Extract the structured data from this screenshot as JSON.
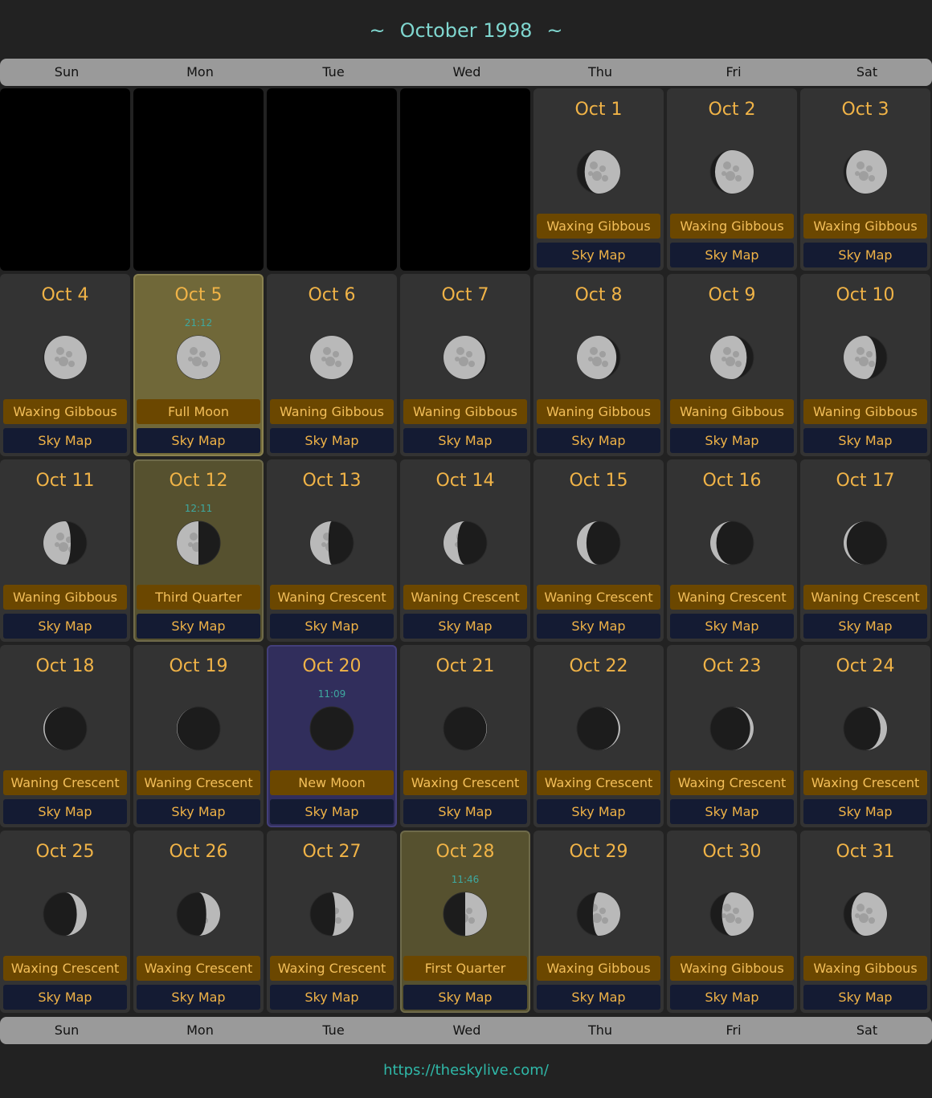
{
  "title": "October 1998",
  "title_decoration": "~",
  "weekdays": [
    "Sun",
    "Mon",
    "Tue",
    "Wed",
    "Thu",
    "Fri",
    "Sat"
  ],
  "sky_map_label": "Sky Map",
  "footer_url": "https://theskylive.com/",
  "first_weekday_index": 4,
  "days": [
    {
      "date": "Oct 1",
      "phase": "Waxing Gibbous",
      "illumination": 0.82,
      "waxing": true
    },
    {
      "date": "Oct 2",
      "phase": "Waxing Gibbous",
      "illumination": 0.89,
      "waxing": true
    },
    {
      "date": "Oct 3",
      "phase": "Waxing Gibbous",
      "illumination": 0.94,
      "waxing": true
    },
    {
      "date": "Oct 4",
      "phase": "Waxing Gibbous",
      "illumination": 0.98,
      "waxing": true
    },
    {
      "date": "Oct 5",
      "phase": "Full Moon",
      "time": "21:12",
      "illumination": 1.0,
      "waxing": true,
      "highlight": "full"
    },
    {
      "date": "Oct 6",
      "phase": "Waning Gibbous",
      "illumination": 0.99,
      "waxing": false
    },
    {
      "date": "Oct 7",
      "phase": "Waning Gibbous",
      "illumination": 0.96,
      "waxing": false
    },
    {
      "date": "Oct 8",
      "phase": "Waning Gibbous",
      "illumination": 0.91,
      "waxing": false
    },
    {
      "date": "Oct 9",
      "phase": "Waning Gibbous",
      "illumination": 0.84,
      "waxing": false
    },
    {
      "date": "Oct 10",
      "phase": "Waning Gibbous",
      "illumination": 0.75,
      "waxing": false
    },
    {
      "date": "Oct 11",
      "phase": "Waning Gibbous",
      "illumination": 0.63,
      "waxing": false
    },
    {
      "date": "Oct 12",
      "phase": "Third Quarter",
      "time": "12:11",
      "illumination": 0.5,
      "waxing": false,
      "highlight": "quarter"
    },
    {
      "date": "Oct 13",
      "phase": "Waning Crescent",
      "illumination": 0.42,
      "waxing": false
    },
    {
      "date": "Oct 14",
      "phase": "Waning Crescent",
      "illumination": 0.32,
      "waxing": false
    },
    {
      "date": "Oct 15",
      "phase": "Waning Crescent",
      "illumination": 0.22,
      "waxing": false
    },
    {
      "date": "Oct 16",
      "phase": "Waning Crescent",
      "illumination": 0.14,
      "waxing": false
    },
    {
      "date": "Oct 17",
      "phase": "Waning Crescent",
      "illumination": 0.07,
      "waxing": false
    },
    {
      "date": "Oct 18",
      "phase": "Waning Crescent",
      "illumination": 0.03,
      "waxing": false
    },
    {
      "date": "Oct 19",
      "phase": "Waning Crescent",
      "illumination": 0.01,
      "waxing": false
    },
    {
      "date": "Oct 20",
      "phase": "New Moon",
      "time": "11:09",
      "illumination": 0.0,
      "waxing": true,
      "highlight": "new"
    },
    {
      "date": "Oct 21",
      "phase": "Waxing Crescent",
      "illumination": 0.01,
      "waxing": true
    },
    {
      "date": "Oct 22",
      "phase": "Waxing Crescent",
      "illumination": 0.04,
      "waxing": true
    },
    {
      "date": "Oct 23",
      "phase": "Waxing Crescent",
      "illumination": 0.08,
      "waxing": true
    },
    {
      "date": "Oct 24",
      "phase": "Waxing Crescent",
      "illumination": 0.15,
      "waxing": true
    },
    {
      "date": "Oct 25",
      "phase": "Waxing Crescent",
      "illumination": 0.23,
      "waxing": true
    },
    {
      "date": "Oct 26",
      "phase": "Waxing Crescent",
      "illumination": 0.32,
      "waxing": true
    },
    {
      "date": "Oct 27",
      "phase": "Waxing Crescent",
      "illumination": 0.42,
      "waxing": true
    },
    {
      "date": "Oct 28",
      "phase": "First Quarter",
      "time": "11:46",
      "illumination": 0.5,
      "waxing": true,
      "highlight": "quarter"
    },
    {
      "date": "Oct 29",
      "phase": "Waxing Gibbous",
      "illumination": 0.63,
      "waxing": true
    },
    {
      "date": "Oct 30",
      "phase": "Waxing Gibbous",
      "illumination": 0.73,
      "waxing": true
    },
    {
      "date": "Oct 31",
      "phase": "Waxing Gibbous",
      "illumination": 0.82,
      "waxing": true
    }
  ],
  "colors": {
    "background": "#222222",
    "cell": "#333333",
    "date_text": "#f0b347",
    "phase_bg": "#6b4700",
    "skymap_bg": "#141b33",
    "title_text": "#7fd6cf",
    "full_moon_cell": "#706839",
    "quarter_cell": "#56512f",
    "new_moon_cell": "#312e5c"
  }
}
